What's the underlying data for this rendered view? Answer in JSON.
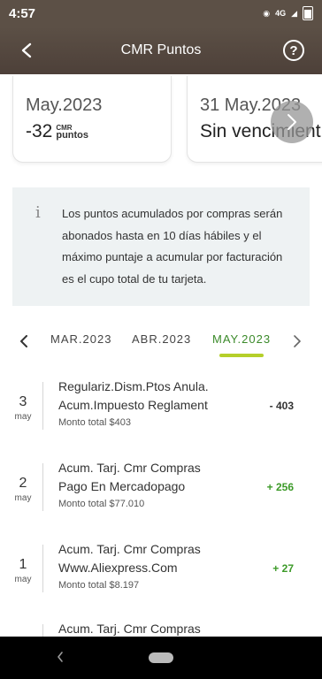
{
  "status_bar": {
    "time": "4:57",
    "network": "4G",
    "battery": "97"
  },
  "app_bar": {
    "back_icon": "arrow-left-icon",
    "title": "CMR Puntos",
    "help_label": "?"
  },
  "cards": [
    {
      "date": "May.2023",
      "value": "-32",
      "unit_top": "CMR",
      "unit_bottom": "puntos"
    },
    {
      "date": "31 May.2023",
      "value": "Sin vencimient"
    }
  ],
  "info": {
    "icon": "info-icon",
    "glyph": "i",
    "text": "Los puntos acumulados por compras serán abonados hasta en 10 días hábiles y el máximo puntaje a acumular por facturación es el cupo total de tu tarjeta."
  },
  "months": {
    "prev": "MAR.2023",
    "middle": "ABR.2023",
    "current": "MAY.2023"
  },
  "transactions": [
    {
      "day": "3",
      "month": "may",
      "line1": "Regulariz.Dism.Ptos Anula.",
      "line2": "Acum.Impuesto Reglament",
      "total": "Monto total $403",
      "points": "- 403"
    },
    {
      "day": "2",
      "month": "may",
      "line1": "Acum. Tarj. Cmr Compras",
      "line2": "Pago En Mercadopago",
      "total": "Monto total $77.010",
      "points": "+ 256"
    },
    {
      "day": "1",
      "month": "may",
      "line1": "Acum. Tarj. Cmr Compras",
      "line2": "Www.Aliexpress.Com",
      "total": "Monto total $8.197",
      "points": "+ 27"
    },
    {
      "line1": "Acum. Tarj. Cmr Compras"
    }
  ],
  "colors": {
    "header": "#5c5046",
    "accent_green": "#3c9a28",
    "underline": "#b5cf2a",
    "info_bg": "#eef2f3"
  }
}
